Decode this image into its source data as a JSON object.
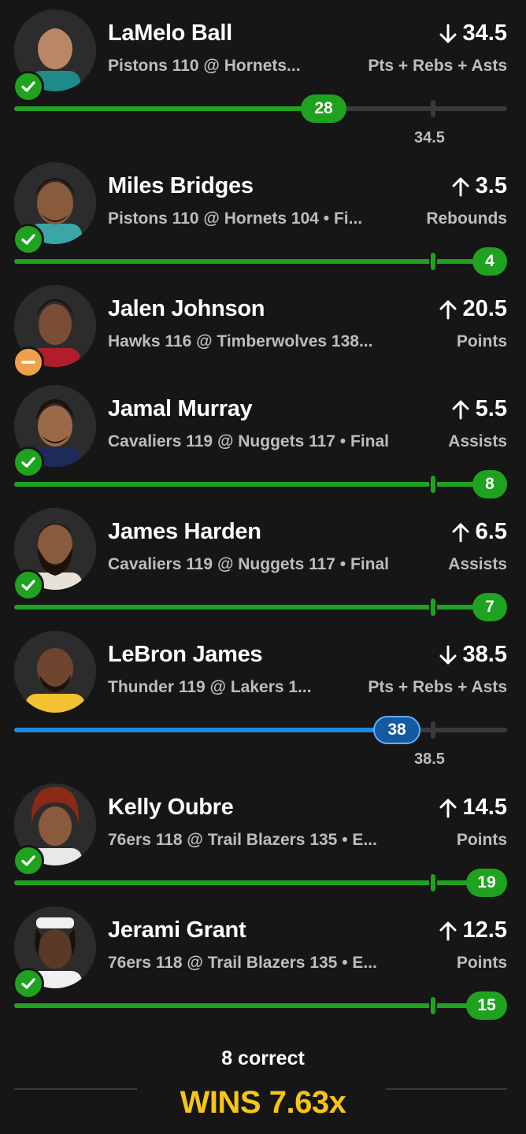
{
  "picks": [
    {
      "name": "LaMelo Ball",
      "game": "Pistons 110 @ Hornets...",
      "direction": "down",
      "line": "34.5",
      "stat": "Pts + Rebs + Asts",
      "result": "win",
      "actual": "28",
      "line_label": "34.5",
      "bar_color": "green",
      "fraction": 0.81
    },
    {
      "name": "Miles Bridges",
      "game": "Pistons 110 @ Hornets 104 • Fi...",
      "direction": "up",
      "line": "3.5",
      "stat": "Rebounds",
      "result": "win",
      "actual": "4",
      "bar_color": "green",
      "fraction": 1.0
    },
    {
      "name": "Jalen Johnson",
      "game": "Hawks 116 @ Timberwolves 138...",
      "direction": "up",
      "line": "20.5",
      "stat": "Points",
      "result": "push"
    },
    {
      "name": "Jamal Murray",
      "game": "Cavaliers 119 @ Nuggets 117 • Final",
      "direction": "up",
      "line": "5.5",
      "stat": "Assists",
      "result": "win",
      "actual": "8",
      "bar_color": "green",
      "fraction": 1.0
    },
    {
      "name": "James Harden",
      "game": "Cavaliers 119 @ Nuggets 117 • Final",
      "direction": "up",
      "line": "6.5",
      "stat": "Assists",
      "result": "win",
      "actual": "7",
      "bar_color": "green",
      "fraction": 1.0
    },
    {
      "name": "LeBron James",
      "game": "Thunder 119 @ Lakers 1...",
      "direction": "down",
      "line": "38.5",
      "stat": "Pts + Rebs + Asts",
      "result": "none",
      "actual": "38",
      "line_label": "38.5",
      "bar_color": "blue",
      "fraction": 0.98
    },
    {
      "name": "Kelly Oubre",
      "game": "76ers 118 @ Trail Blazers 135 • E...",
      "direction": "up",
      "line": "14.5",
      "stat": "Points",
      "result": "win",
      "actual": "19",
      "bar_color": "green",
      "fraction": 1.0
    },
    {
      "name": "Jerami Grant",
      "game": "76ers 118 @ Trail Blazers 135 • E...",
      "direction": "up",
      "line": "12.5",
      "stat": "Points",
      "result": "win",
      "actual": "15",
      "bar_color": "green",
      "fraction": 1.0
    }
  ],
  "footer": {
    "correct_text": "8 correct",
    "wins_text": "WINS 7.63x"
  },
  "colors": {
    "background": "#161616",
    "win_green": "#1fa21f",
    "push_orange": "#f0a04a",
    "blue": "#1f8be0",
    "gold": "#f5c518"
  }
}
